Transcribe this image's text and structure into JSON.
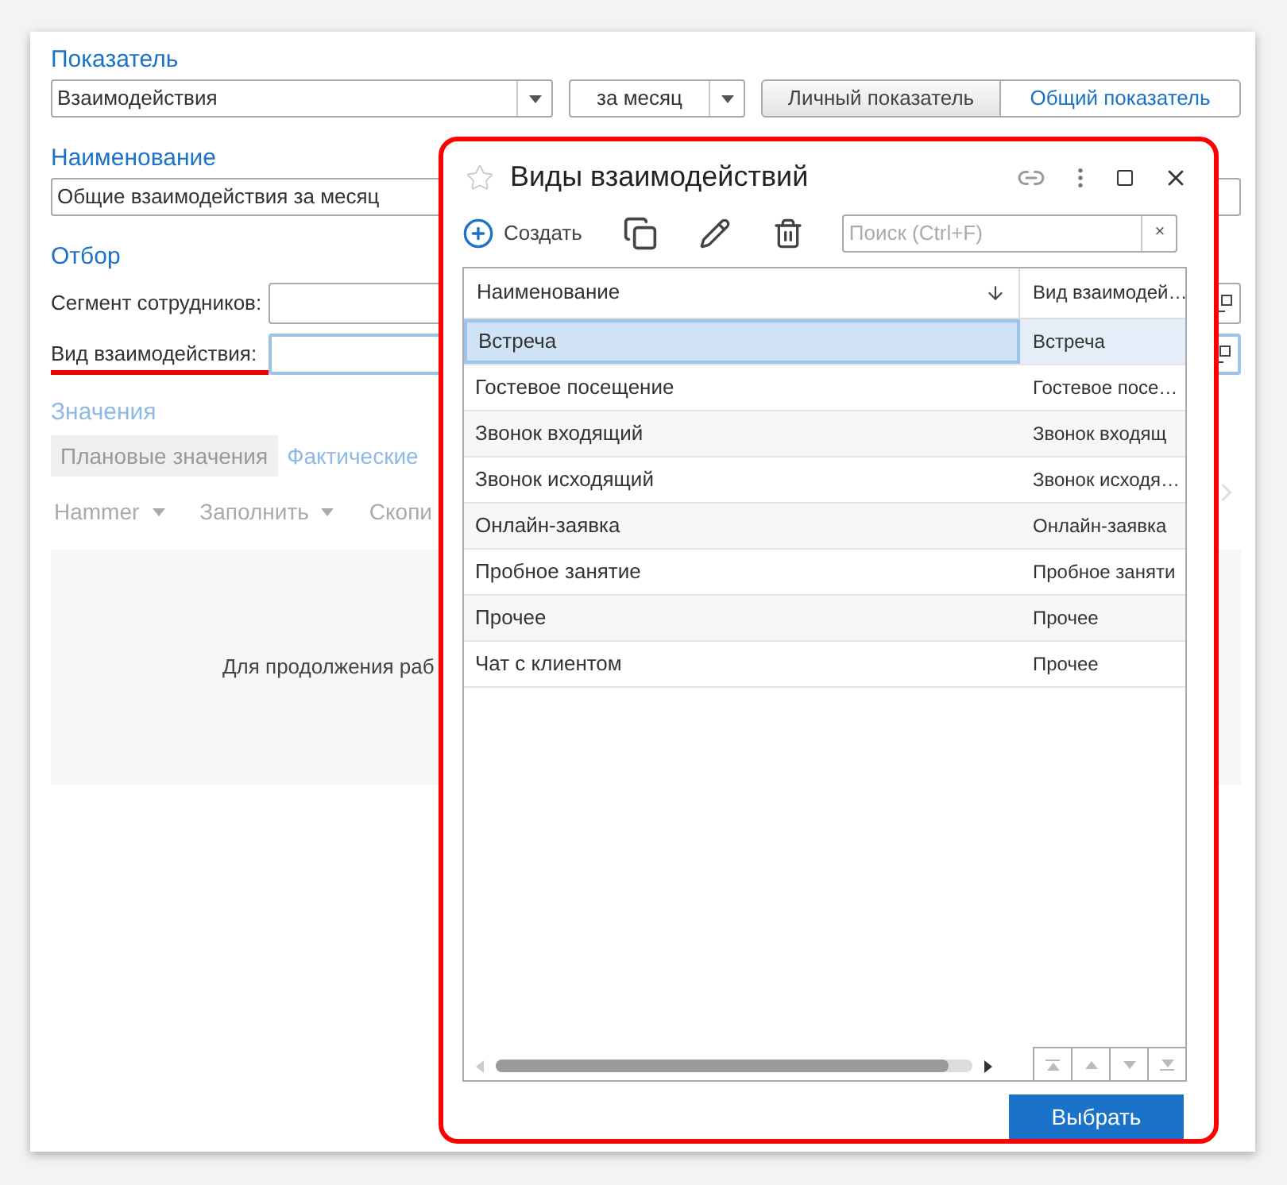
{
  "form": {
    "indicator": {
      "label": "Показатель",
      "value": "Взаимодействия",
      "period": "за месяц",
      "scope_tabs": [
        {
          "label": "Личный показатель",
          "selected": true
        },
        {
          "label": "Общий показатель",
          "selected": false
        }
      ]
    },
    "name": {
      "label": "Наименование",
      "value": "Общие взаимодействия за месяц"
    },
    "filter": {
      "label": "Отбор",
      "fields": [
        {
          "label": "Сегмент сотрудников:",
          "highlighted": false
        },
        {
          "label": "Вид взаимодействия:",
          "highlighted": true
        }
      ]
    },
    "values": {
      "label": "Значения",
      "tabs": [
        {
          "label": "Плановые значения",
          "selected": true
        },
        {
          "label": "Фактические",
          "selected": false
        }
      ],
      "toolbar": [
        {
          "label": "Hammer",
          "dropdown": true
        },
        {
          "label": "Заполнить",
          "dropdown": true
        },
        {
          "label": "Скопи",
          "dropdown": false
        }
      ],
      "notice": "Для продолжения раб"
    }
  },
  "dialog": {
    "title": "Виды взаимодействий",
    "create_label": "Создать",
    "search": {
      "placeholder": "Поиск (Ctrl+F)",
      "clear": "×"
    },
    "columns": [
      {
        "label": "Наименование",
        "sorted": true
      },
      {
        "label": "Вид взаимодей…",
        "sorted": false
      }
    ],
    "rows": [
      {
        "name": "Встреча",
        "kind_value": "Встреча",
        "selected": true
      },
      {
        "name": "Гостевое посещение",
        "kind_value": "Гостевое посе…",
        "selected": false
      },
      {
        "name": "Звонок входящий",
        "kind_value": "Звонок входящ",
        "selected": false
      },
      {
        "name": "Звонок исходящий",
        "kind_value": "Звонок исходя…",
        "selected": false
      },
      {
        "name": "Онлайн-заявка",
        "kind_value": "Онлайн-заявка",
        "selected": false
      },
      {
        "name": "Пробное занятие",
        "kind_value": "Пробное заняти",
        "selected": false
      },
      {
        "name": "Прочее",
        "kind_value": "Прочее",
        "selected": false
      },
      {
        "name": "Чат с клиентом",
        "kind_value": "Прочее",
        "selected": false
      }
    ],
    "choose_button": "Выбрать"
  }
}
